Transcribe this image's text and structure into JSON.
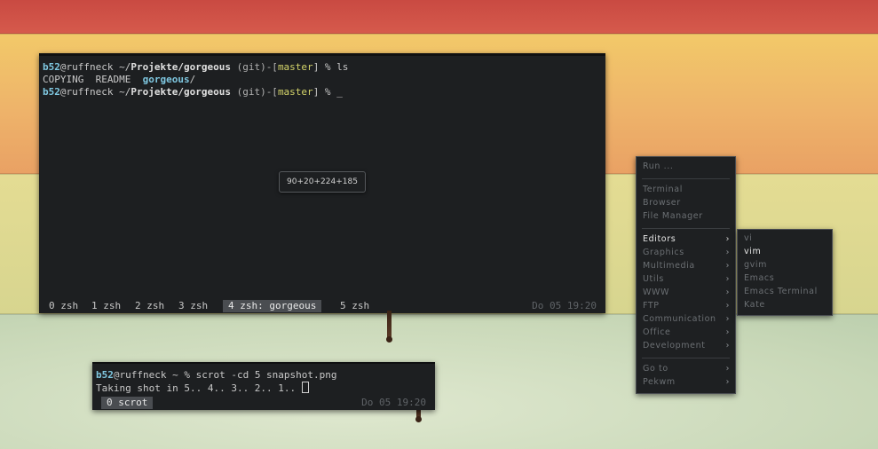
{
  "main_terminal": {
    "lines": [
      {
        "user": "b52",
        "host": "@ruffneck ",
        "path_base": "~/",
        "path_bold": "Projekte/gorgeous",
        "git": " (git)-[",
        "branch": "master",
        "tail": "] % ls"
      },
      {
        "plain": "COPYING  README  ",
        "dir": "gorgeous",
        "dir_tail": "/"
      },
      {
        "user": "b52",
        "host": "@ruffneck ",
        "path_base": "~/",
        "path_bold": "Projekte/gorgeous",
        "git": " (git)-[",
        "branch": "master",
        "tail": "] % ",
        "cursor": "_"
      }
    ],
    "tabs": [
      "0 zsh",
      "1 zsh",
      "2 zsh",
      "3 zsh",
      "4 zsh: gorgeous",
      "5 zsh"
    ],
    "active_tab": "4 zsh: gorgeous",
    "clock": "Do 05 19:20"
  },
  "geometry_tooltip": "90+20+224+185",
  "small_terminal": {
    "line1": {
      "user": "b52",
      "rest": "@ruffneck ~ % scrot -cd 5 snapshot.png"
    },
    "line2": "Taking shot in 5.. 4.. 3.. 2.. 1.. ",
    "tab": "0 scrot",
    "clock": "Do 05 19:20"
  },
  "main_menu": {
    "run": "Run ...",
    "apps": [
      "Terminal",
      "Browser",
      "File Manager"
    ],
    "categories": [
      "Editors",
      "Graphics",
      "Multimedia",
      "Utils",
      "WWW",
      "FTP",
      "Communication",
      "Office",
      "Development"
    ],
    "highlighted": "Editors",
    "bottom": [
      "Go to",
      "Pekwm"
    ],
    "arrow": "›"
  },
  "editors_submenu": {
    "items": [
      "vi",
      "vim",
      "gvim",
      "Emacs",
      "Emacs Terminal",
      "Kate"
    ],
    "highlighted": "vim"
  },
  "colors": {
    "terminal_bg": "#1d1f21",
    "user": "#7fc7e0",
    "branch": "#d4d46a",
    "menu_bg": "#1e2022"
  }
}
